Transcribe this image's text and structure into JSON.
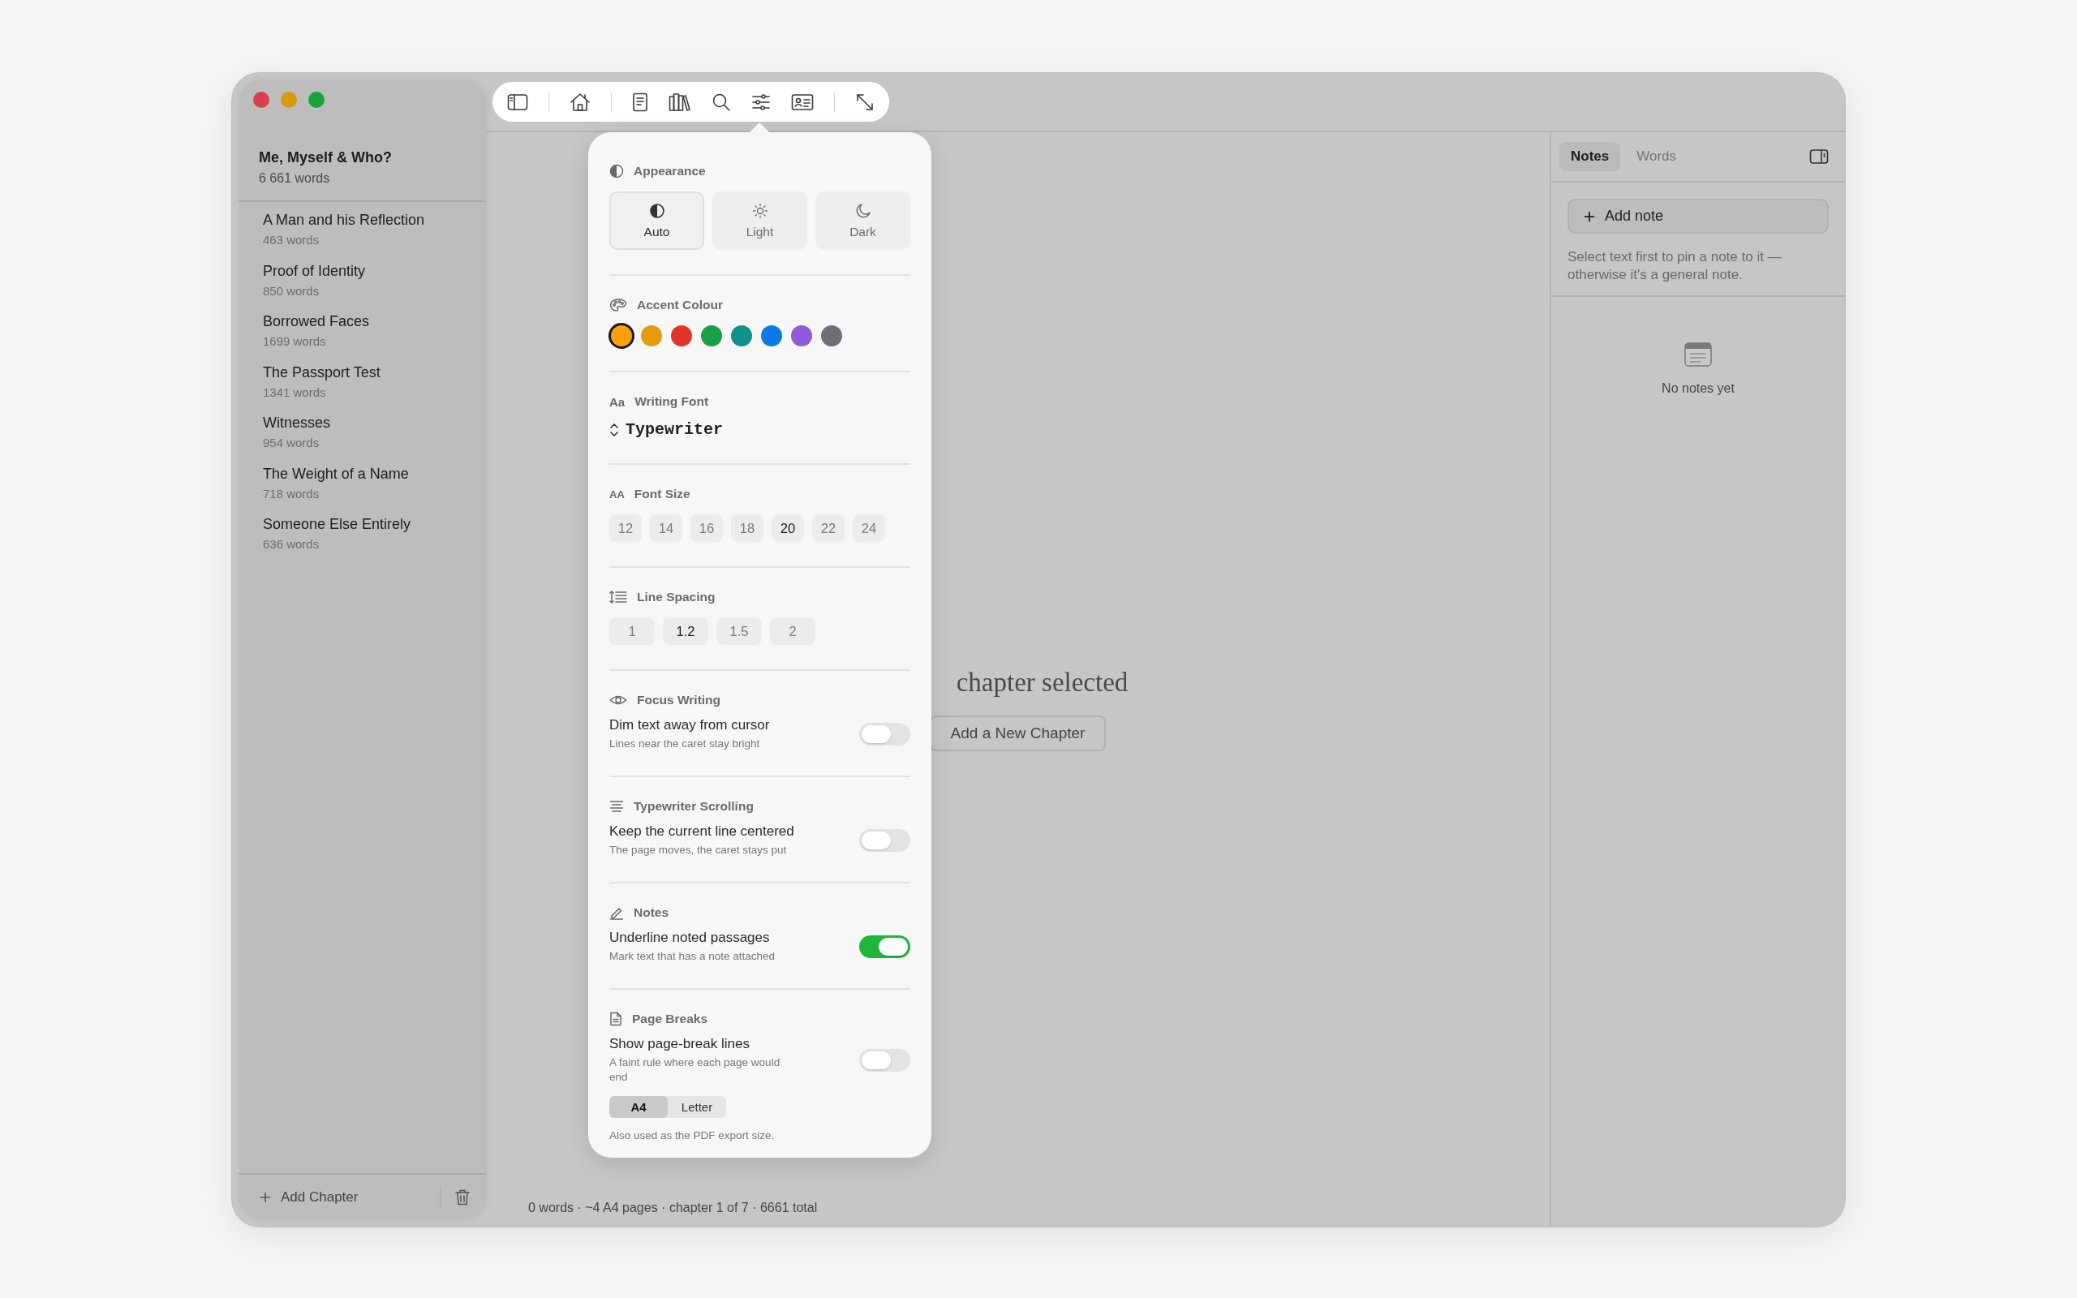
{
  "sidebar": {
    "book_title": "Me, Myself & Who?",
    "book_words": "6 661 words",
    "chapters": [
      {
        "title": "A Man and his Reflection",
        "words": "463 words"
      },
      {
        "title": "Proof of Identity",
        "words": "850 words"
      },
      {
        "title": "Borrowed Faces",
        "words": "1699 words"
      },
      {
        "title": "The Passport Test",
        "words": "1341 words"
      },
      {
        "title": "Witnesses",
        "words": "954 words"
      },
      {
        "title": "The Weight of a Name",
        "words": "718 words"
      },
      {
        "title": "Someone Else Entirely",
        "words": "636 words"
      }
    ],
    "add_button": "Add Chapter"
  },
  "settings": {
    "appearance": {
      "label": "Appearance",
      "options": [
        {
          "kind": "auto",
          "label": "Auto",
          "selected": true
        },
        {
          "kind": "light",
          "label": "Light",
          "selected": false
        },
        {
          "kind": "dark",
          "label": "Dark",
          "selected": false
        }
      ]
    },
    "accent": {
      "label": "Accent Colour",
      "swatches": [
        {
          "color": "#ff9f0a",
          "selected": true
        },
        {
          "color": "#e69b0c",
          "selected": false
        },
        {
          "color": "#e0352b",
          "selected": false
        },
        {
          "color": "#1a9e48",
          "selected": false
        },
        {
          "color": "#0f918c",
          "selected": false
        },
        {
          "color": "#0a7ae6",
          "selected": false
        },
        {
          "color": "#8e5bd9",
          "selected": false
        },
        {
          "color": "#6e6e78",
          "selected": false
        }
      ]
    },
    "font": {
      "glyph": "Aa",
      "label": "Writing Font",
      "value": "Typewriter"
    },
    "font_size": {
      "glyph": "AA",
      "label": "Font Size",
      "options": [
        {
          "label": "12",
          "selected": false
        },
        {
          "label": "14",
          "selected": false
        },
        {
          "label": "16",
          "selected": false
        },
        {
          "label": "18",
          "selected": false
        },
        {
          "label": "20",
          "selected": true
        },
        {
          "label": "22",
          "selected": false
        },
        {
          "label": "24",
          "selected": false
        }
      ]
    },
    "line_spacing": {
      "label": "Line Spacing",
      "options": [
        {
          "label": "1",
          "selected": false
        },
        {
          "label": "1.2",
          "selected": true
        },
        {
          "label": "1.5",
          "selected": false
        },
        {
          "label": "2",
          "selected": false
        }
      ]
    },
    "sections": [
      {
        "kind": "focus",
        "label": "Focus Writing",
        "title": "Dim text away from cursor",
        "subtitle": "Lines near the caret stay bright",
        "on": false
      },
      {
        "kind": "scrolling",
        "label": "Typewriter Scrolling",
        "title": "Keep the current line centered",
        "subtitle": "The page moves, the caret stays put",
        "on": false
      },
      {
        "kind": "notes",
        "label": "Notes",
        "title": "Underline noted passages",
        "subtitle": "Mark text that has a note attached",
        "on": true
      },
      {
        "kind": "page_breaks",
        "label": "Page Breaks",
        "title": "Show page-break lines",
        "subtitle": "A faint rule where each page would end",
        "on": false,
        "paper_sizes": [
          {
            "label": "A4",
            "selected": true
          },
          {
            "label": "Letter",
            "selected": false
          }
        ],
        "note": "Also used as the PDF export size."
      }
    ]
  },
  "editor": {
    "empty_message": "chapter selected",
    "add_button": "Add a New Chapter",
    "status": "0 words · ~4 A4 pages · chapter 1 of 7 · 6661 total"
  },
  "notes_panel": {
    "tabs": [
      {
        "label": "Notes",
        "selected": true
      },
      {
        "label": "Words",
        "selected": false
      }
    ],
    "add_button": "Add note",
    "hint": "Select text first to pin a note to it — otherwise it's a general note.",
    "empty": "No notes yet"
  }
}
